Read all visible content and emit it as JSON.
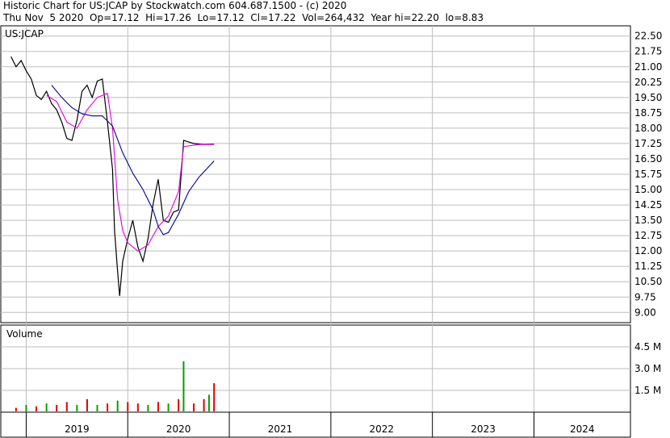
{
  "header": {
    "line1": "Historic Chart for US:JCAP by Stockwatch.com 604.687.1500 - (c) 2020",
    "line2": "Thu Nov  5 2020  Op=17.12  Hi=17.26  Lo=17.12  Cl=17.22  Vol=264,432  Year hi=22.20  lo=8.83"
  },
  "chart_data": [
    {
      "type": "line",
      "title": "US:JCAP",
      "y_ticks": [
        "22.50",
        "21.75",
        "21.00",
        "20.25",
        "19.50",
        "18.75",
        "18.00",
        "17.25",
        "16.50",
        "15.75",
        "15.00",
        "14.25",
        "13.50",
        "12.75",
        "12.00",
        "11.25",
        "10.50",
        "9.75",
        "9.00"
      ],
      "ylim": [
        8.5,
        23.0
      ],
      "x_labels": [
        "2019",
        "2020",
        "2021",
        "2022",
        "2023",
        "2024"
      ],
      "grid": true,
      "series": [
        {
          "name": "price",
          "color": "#000000",
          "values": [
            {
              "t": 2018.85,
              "v": 21.5
            },
            {
              "t": 2018.9,
              "v": 21.0
            },
            {
              "t": 2018.95,
              "v": 21.3
            },
            {
              "t": 2019.0,
              "v": 20.8
            },
            {
              "t": 2019.05,
              "v": 20.4
            },
            {
              "t": 2019.1,
              "v": 19.6
            },
            {
              "t": 2019.15,
              "v": 19.4
            },
            {
              "t": 2019.2,
              "v": 19.8
            },
            {
              "t": 2019.25,
              "v": 19.2
            },
            {
              "t": 2019.3,
              "v": 18.9
            },
            {
              "t": 2019.35,
              "v": 18.3
            },
            {
              "t": 2019.4,
              "v": 17.5
            },
            {
              "t": 2019.45,
              "v": 17.4
            },
            {
              "t": 2019.5,
              "v": 18.4
            },
            {
              "t": 2019.55,
              "v": 19.8
            },
            {
              "t": 2019.6,
              "v": 20.1
            },
            {
              "t": 2019.65,
              "v": 19.5
            },
            {
              "t": 2019.7,
              "v": 20.3
            },
            {
              "t": 2019.75,
              "v": 20.4
            },
            {
              "t": 2019.8,
              "v": 18.3
            },
            {
              "t": 2019.85,
              "v": 16.0
            },
            {
              "t": 2019.87,
              "v": 13.0
            },
            {
              "t": 2019.9,
              "v": 11.0
            },
            {
              "t": 2019.92,
              "v": 9.8
            },
            {
              "t": 2019.95,
              "v": 11.5
            },
            {
              "t": 2020.0,
              "v": 12.6
            },
            {
              "t": 2020.05,
              "v": 13.5
            },
            {
              "t": 2020.1,
              "v": 12.2
            },
            {
              "t": 2020.15,
              "v": 11.5
            },
            {
              "t": 2020.2,
              "v": 12.6
            },
            {
              "t": 2020.25,
              "v": 14.3
            },
            {
              "t": 2020.3,
              "v": 15.5
            },
            {
              "t": 2020.35,
              "v": 13.5
            },
            {
              "t": 2020.4,
              "v": 13.4
            },
            {
              "t": 2020.45,
              "v": 13.9
            },
            {
              "t": 2020.5,
              "v": 14.0
            },
            {
              "t": 2020.55,
              "v": 17.4
            },
            {
              "t": 2020.65,
              "v": 17.25
            },
            {
              "t": 2020.75,
              "v": 17.2
            },
            {
              "t": 2020.85,
              "v": 17.22
            }
          ]
        },
        {
          "name": "ma-fast",
          "color": "#e000e0",
          "values": [
            {
              "t": 2019.2,
              "v": 19.6
            },
            {
              "t": 2019.3,
              "v": 19.3
            },
            {
              "t": 2019.4,
              "v": 18.3
            },
            {
              "t": 2019.5,
              "v": 18.0
            },
            {
              "t": 2019.6,
              "v": 18.9
            },
            {
              "t": 2019.7,
              "v": 19.5
            },
            {
              "t": 2019.8,
              "v": 19.7
            },
            {
              "t": 2019.85,
              "v": 18.0
            },
            {
              "t": 2019.9,
              "v": 14.5
            },
            {
              "t": 2019.95,
              "v": 13.0
            },
            {
              "t": 2020.0,
              "v": 12.4
            },
            {
              "t": 2020.1,
              "v": 12.0
            },
            {
              "t": 2020.2,
              "v": 12.3
            },
            {
              "t": 2020.3,
              "v": 13.2
            },
            {
              "t": 2020.4,
              "v": 13.7
            },
            {
              "t": 2020.5,
              "v": 14.9
            },
            {
              "t": 2020.55,
              "v": 17.1
            },
            {
              "t": 2020.7,
              "v": 17.2
            },
            {
              "t": 2020.85,
              "v": 17.2
            }
          ]
        },
        {
          "name": "ma-slow",
          "color": "#000090",
          "values": [
            {
              "t": 2019.25,
              "v": 20.1
            },
            {
              "t": 2019.35,
              "v": 19.5
            },
            {
              "t": 2019.45,
              "v": 19.0
            },
            {
              "t": 2019.55,
              "v": 18.7
            },
            {
              "t": 2019.65,
              "v": 18.6
            },
            {
              "t": 2019.75,
              "v": 18.6
            },
            {
              "t": 2019.85,
              "v": 18.1
            },
            {
              "t": 2019.95,
              "v": 16.8
            },
            {
              "t": 2020.05,
              "v": 15.8
            },
            {
              "t": 2020.15,
              "v": 15.0
            },
            {
              "t": 2020.25,
              "v": 14.0
            },
            {
              "t": 2020.3,
              "v": 13.2
            },
            {
              "t": 2020.35,
              "v": 12.8
            },
            {
              "t": 2020.4,
              "v": 12.9
            },
            {
              "t": 2020.5,
              "v": 13.8
            },
            {
              "t": 2020.6,
              "v": 14.9
            },
            {
              "t": 2020.7,
              "v": 15.6
            },
            {
              "t": 2020.85,
              "v": 16.4
            }
          ]
        }
      ]
    },
    {
      "type": "bar",
      "title": "Volume",
      "y_ticks": [
        "4.5 M",
        "3.0 M",
        "1.5 M"
      ],
      "ylim": [
        0,
        6.0
      ],
      "units": "M",
      "bars": [
        {
          "t": 2018.9,
          "v": 0.3,
          "c": "red"
        },
        {
          "t": 2019.0,
          "v": 0.5,
          "c": "green"
        },
        {
          "t": 2019.1,
          "v": 0.4,
          "c": "red"
        },
        {
          "t": 2019.2,
          "v": 0.6,
          "c": "green"
        },
        {
          "t": 2019.3,
          "v": 0.5,
          "c": "red"
        },
        {
          "t": 2019.4,
          "v": 0.7,
          "c": "red"
        },
        {
          "t": 2019.5,
          "v": 0.5,
          "c": "green"
        },
        {
          "t": 2019.6,
          "v": 0.9,
          "c": "red"
        },
        {
          "t": 2019.7,
          "v": 0.5,
          "c": "green"
        },
        {
          "t": 2019.8,
          "v": 0.6,
          "c": "red"
        },
        {
          "t": 2019.9,
          "v": 0.8,
          "c": "green"
        },
        {
          "t": 2020.0,
          "v": 0.7,
          "c": "red"
        },
        {
          "t": 2020.1,
          "v": 0.6,
          "c": "red"
        },
        {
          "t": 2020.2,
          "v": 0.5,
          "c": "green"
        },
        {
          "t": 2020.3,
          "v": 0.7,
          "c": "red"
        },
        {
          "t": 2020.4,
          "v": 0.6,
          "c": "green"
        },
        {
          "t": 2020.5,
          "v": 0.9,
          "c": "red"
        },
        {
          "t": 2020.55,
          "v": 3.5,
          "c": "green"
        },
        {
          "t": 2020.65,
          "v": 0.6,
          "c": "red"
        },
        {
          "t": 2020.75,
          "v": 0.9,
          "c": "red"
        },
        {
          "t": 2020.8,
          "v": 1.2,
          "c": "green"
        },
        {
          "t": 2020.85,
          "v": 2.0,
          "c": "red"
        }
      ]
    }
  ]
}
